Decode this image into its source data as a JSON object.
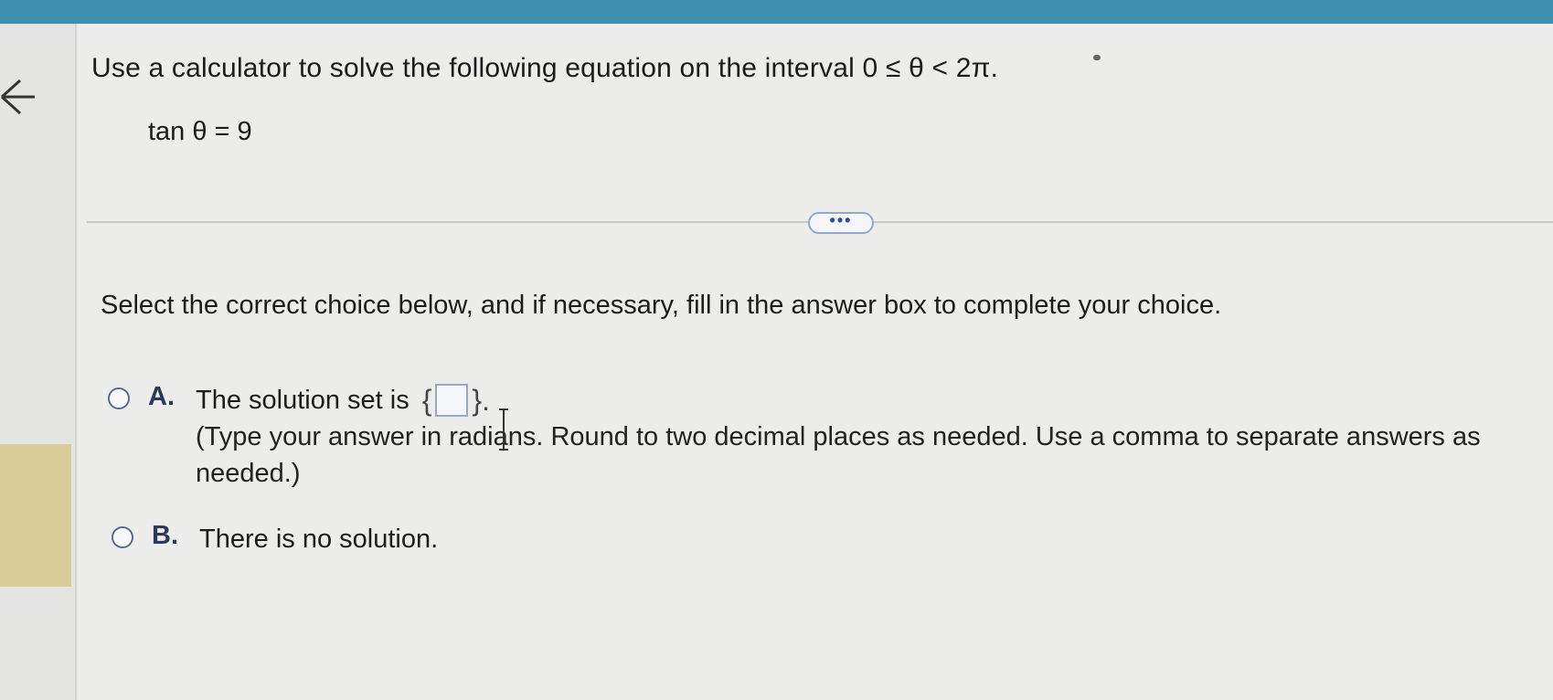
{
  "question": {
    "prompt": "Use a calculator to solve the following equation on the interval 0 ≤ θ < 2π.",
    "equation": "tan θ = 9"
  },
  "divider": {
    "more_label": "•••"
  },
  "instruction": "Select the correct choice below, and if necessary, fill in the answer box to complete your choice.",
  "choices": [
    {
      "letter": "A.",
      "text_before": "The solution set is",
      "brace_open": "{",
      "brace_close": "}.",
      "answer_value": "",
      "hint": "(Type your answer in radians. Round to two decimal places as needed. Use a comma to separate answers as needed.)"
    },
    {
      "letter": "B.",
      "text": "There is no solution."
    }
  ],
  "icons": {
    "back": "back-arrow-icon",
    "more": "ellipsis-icon",
    "cursor": "text-cursor-icon"
  },
  "colors": {
    "topbar": "#3f8fb0",
    "highlight": "#d8cd98",
    "choice_letter": "#2b3a5c"
  }
}
